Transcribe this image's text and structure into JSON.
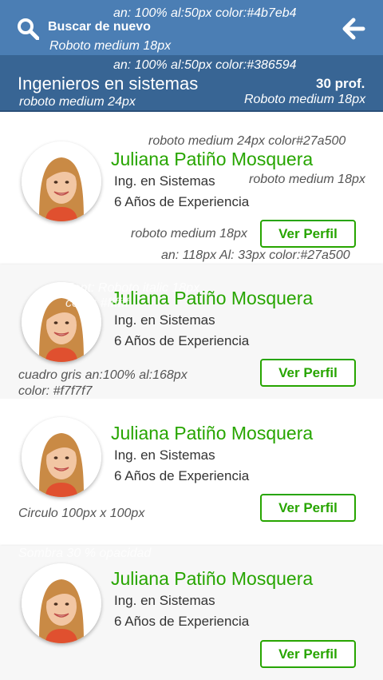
{
  "top_bar": {
    "label": "Buscar de nuevo",
    "color": "#4b7eb4",
    "note_size": "an: 100% al:50px color:#4b7eb4",
    "note_font": "Roboto medium 18px"
  },
  "sub_bar": {
    "title": "Ingenieros en sistemas",
    "count": "30 prof.",
    "color": "#386594",
    "note_size": "an: 100% al:50px color:#386594",
    "note_title_font": "roboto medium 24px",
    "note_count_font": "Roboto medium 18px"
  },
  "cards": [
    {
      "name": "Juliana Patiño Mosquera",
      "role": "Ing. en Sistemas",
      "experience": "6 Años de Experiencia",
      "button": "Ver Perfil"
    },
    {
      "name": "Juliana Patiño Mosquera",
      "role": "Ing. en Sistemas",
      "experience": "6 Años de Experiencia",
      "button": "Ver Perfil"
    },
    {
      "name": "Juliana Patiño Mosquera",
      "role": "Ing. en Sistemas",
      "experience": "6 Años de Experiencia",
      "button": "Ver Perfil"
    },
    {
      "name": "Juliana Patiño Mosquera",
      "role": "Ing. en Sistemas",
      "experience": "6 Años de Experiencia",
      "button": "Ver Perfil"
    }
  ],
  "annotations": {
    "name_font": "roboto medium 24px color#27a500",
    "role_font": "roboto medium 18px",
    "button_font": "roboto medium 18px",
    "button_size": "an: 118px Al: 33px color:#27a500",
    "font_italic": "Font: Roboto italic 18px",
    "font_color": "color: #ffffff",
    "gray_box": "cuadro gris an:100% al:168px",
    "gray_color": "color: #f7f7f7",
    "circle": "Circulo 100px x 100px",
    "shadow": "Sombra 30 % opacidad"
  },
  "colors": {
    "accent": "#27a500",
    "gray_card": "#f7f7f7",
    "note": "#555555"
  },
  "icons": {
    "search": "search-icon",
    "back": "back-arrow-icon"
  }
}
